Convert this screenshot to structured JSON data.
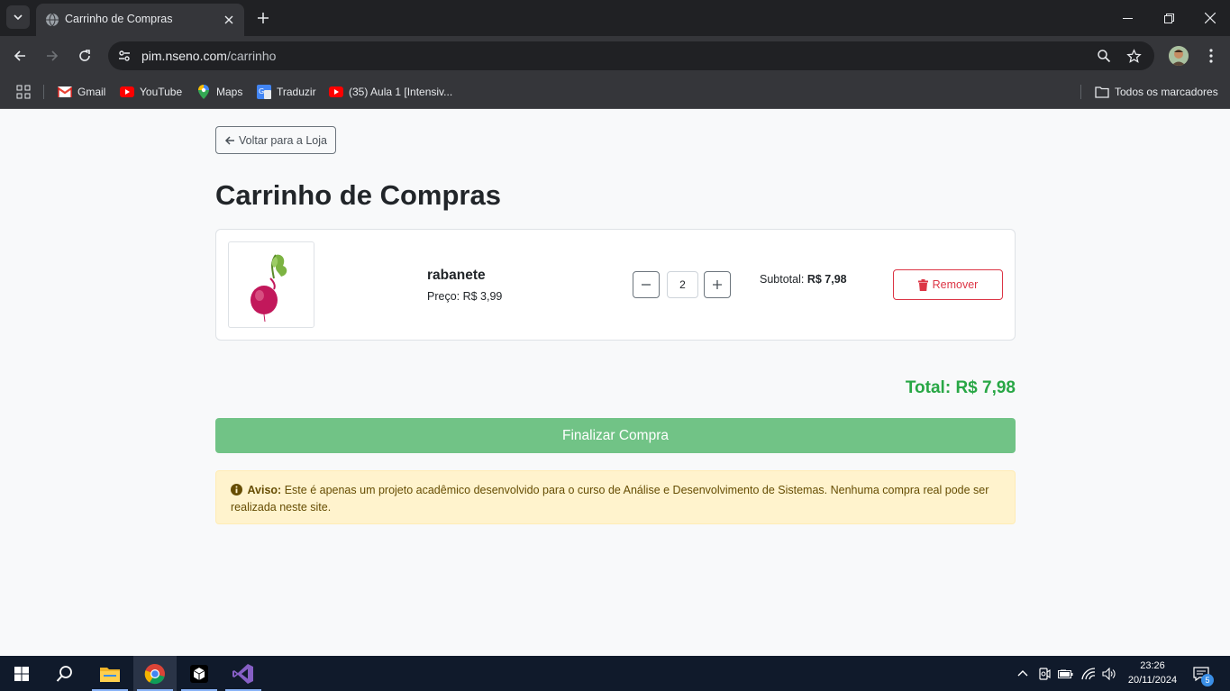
{
  "browser": {
    "tab_title": "Carrinho de Compras",
    "url_host": "pim.nseno.com",
    "url_path": "/carrinho",
    "bookmarks": [
      {
        "label": "Gmail",
        "icon": "gmail-icon"
      },
      {
        "label": "YouTube",
        "icon": "youtube-icon"
      },
      {
        "label": "Maps",
        "icon": "maps-icon"
      },
      {
        "label": "Traduzir",
        "icon": "translate-icon"
      },
      {
        "label": "(35) Aula 1 [Intensiv...",
        "icon": "youtube-icon"
      }
    ],
    "all_bookmarks": "Todos os marcadores"
  },
  "page": {
    "back_label": "Voltar para a Loja",
    "title": "Carrinho de Compras",
    "cart": {
      "items": [
        {
          "name": "rabanete",
          "price": "Preço: R$ 3,99",
          "quantity": "2",
          "subtotal_label": "Subtotal:",
          "subtotal_value": "R$ 7,98",
          "remove_label": "Remover"
        }
      ]
    },
    "total": "Total: R$ 7,98",
    "checkout_label": "Finalizar Compra",
    "alert": {
      "label": "Aviso:",
      "text": "Este é apenas um projeto acadêmico desenvolvido para o curso de Análise e Desenvolvimento de Sistemas. Nenhuma compra real pode ser realizada neste site."
    }
  },
  "colors": {
    "success": "#28a745",
    "danger": "#dc3545",
    "checkout_bg": "#71c386",
    "alert_bg": "#fff3cd"
  },
  "taskbar": {
    "time": "23:26",
    "date": "20/11/2024",
    "notifications": "5"
  }
}
